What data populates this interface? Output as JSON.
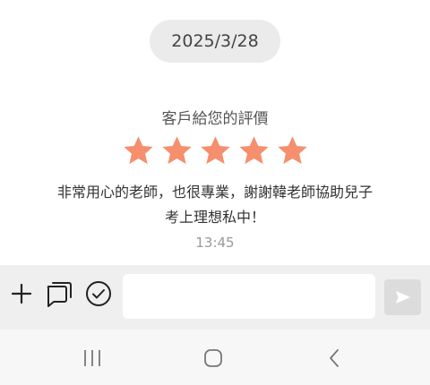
{
  "chat": {
    "date": "2025/3/28",
    "review": {
      "title": "客戶給您的評價",
      "rating": 5,
      "max_rating": 5,
      "star_color": "#f58f6d",
      "text_line1": "非常用心的老師，也很專業，謝謝韓老師協助兒子",
      "text_line2": "考上理想私中！",
      "time": "13:45"
    }
  },
  "input_bar": {
    "icons": [
      "plus-icon",
      "chat-bubbles-icon",
      "check-circle-icon"
    ],
    "message_value": "",
    "send_icon": "send-icon"
  },
  "system_nav": {
    "icons": [
      "recent-apps-icon",
      "home-icon",
      "back-icon"
    ]
  },
  "colors": {
    "background": "#ffffff",
    "date_pill": "#ebebeb",
    "input_bar": "#efefef",
    "send_button": "#dcdcdc",
    "nav_bar": "#f7f7f7"
  }
}
